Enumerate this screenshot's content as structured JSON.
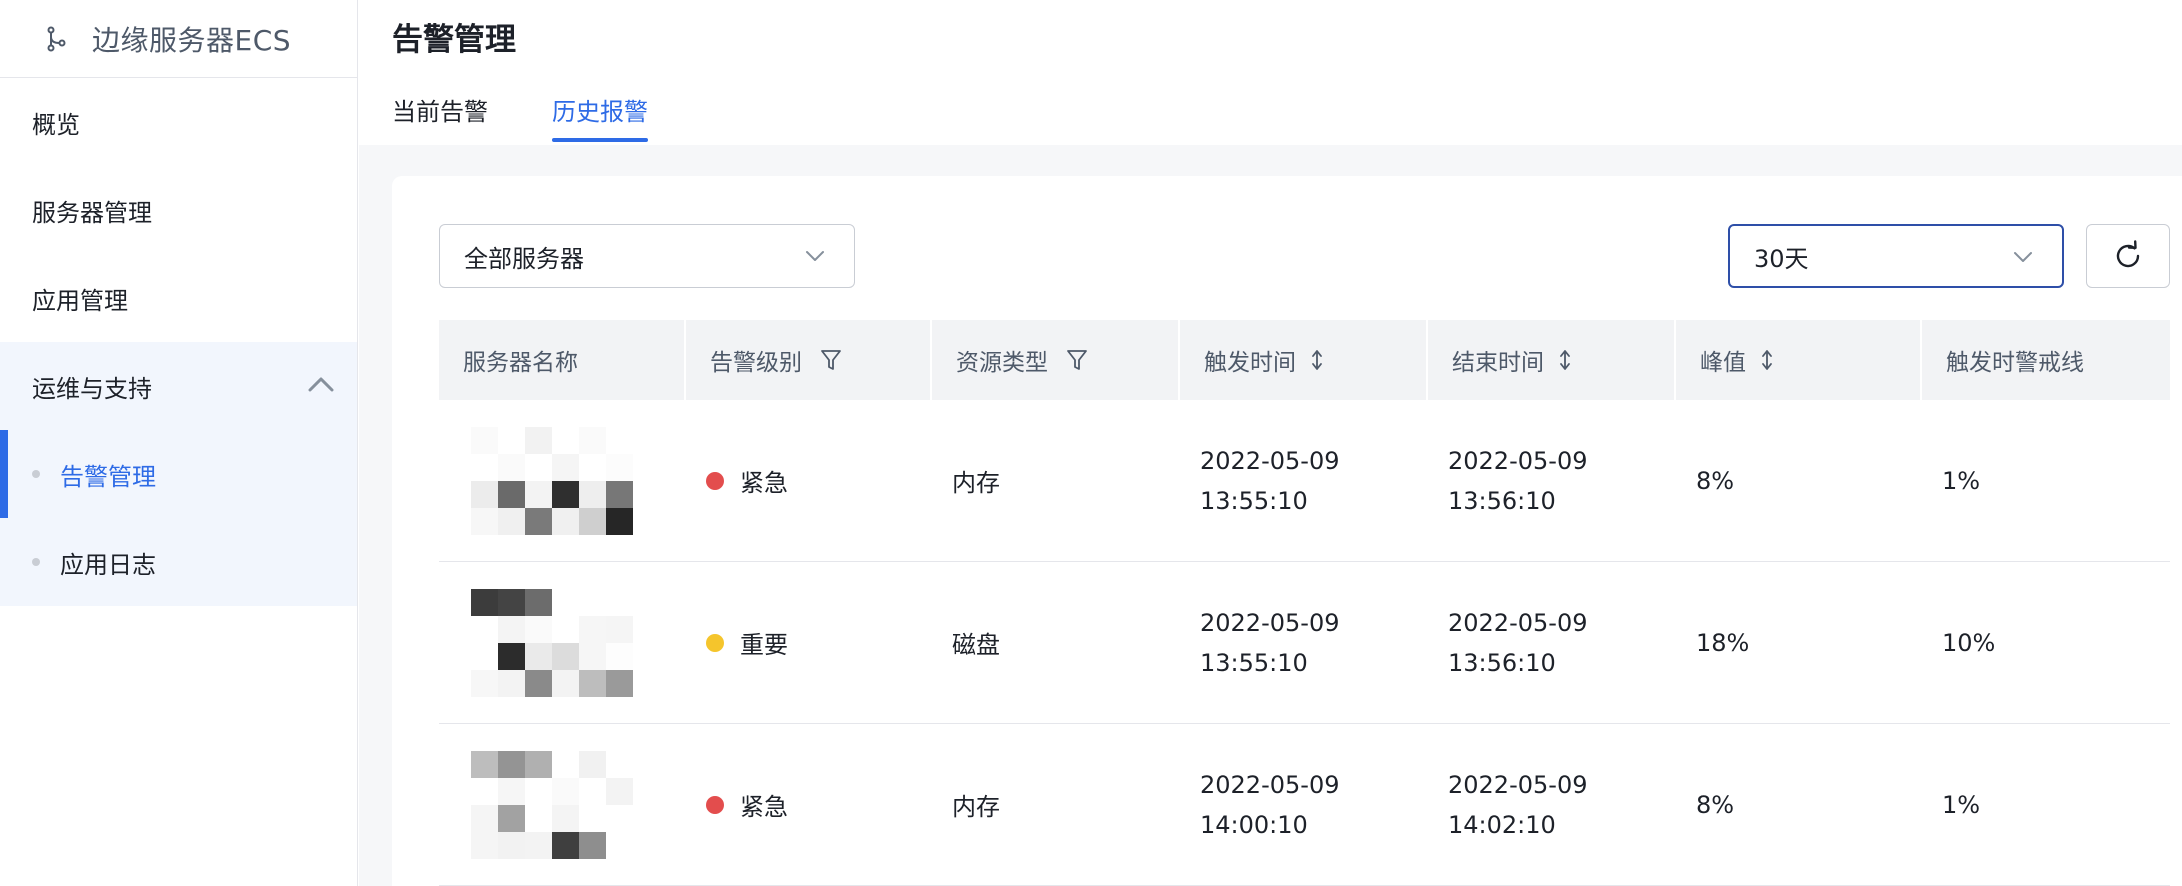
{
  "sidebar": {
    "brand": "边缘服务器ECS",
    "nav": [
      {
        "label": "概览"
      },
      {
        "label": "服务器管理"
      },
      {
        "label": "应用管理"
      }
    ],
    "group": {
      "label": "运维与支持",
      "items": [
        {
          "label": "告警管理",
          "active": true
        },
        {
          "label": "应用日志",
          "active": false
        }
      ]
    }
  },
  "header": {
    "title": "告警管理",
    "tabs": [
      {
        "label": "当前告警",
        "active": false
      },
      {
        "label": "历史报警",
        "active": true
      }
    ]
  },
  "filters": {
    "server_select": "全部服务器",
    "range_select": "30天"
  },
  "table": {
    "columns": [
      "服务器名称",
      "告警级别",
      "资源类型",
      "触发时间",
      "结束时间",
      "峰值",
      "触发时警戒线"
    ],
    "rows": [
      {
        "level": "紧急",
        "level_color": "#e34d4d",
        "resource": "内存",
        "trigger_date": "2022-05-09",
        "trigger_time": "13:55:10",
        "end_date": "2022-05-09",
        "end_time": "13:56:10",
        "peak": "8%",
        "threshold": "1%"
      },
      {
        "level": "重要",
        "level_color": "#f5c52c",
        "resource": "磁盘",
        "trigger_date": "2022-05-09",
        "trigger_time": "13:55:10",
        "end_date": "2022-05-09",
        "end_time": "13:56:10",
        "peak": "18%",
        "threshold": "10%"
      },
      {
        "level": "紧急",
        "level_color": "#e34d4d",
        "resource": "内存",
        "trigger_date": "2022-05-09",
        "trigger_time": "14:00:10",
        "end_date": "2022-05-09",
        "end_time": "14:02:10",
        "peak": "8%",
        "threshold": "1%"
      }
    ]
  },
  "colors": {
    "accent": "#2e6be6",
    "urgent": "#e34d4d",
    "important": "#f5c52c"
  }
}
